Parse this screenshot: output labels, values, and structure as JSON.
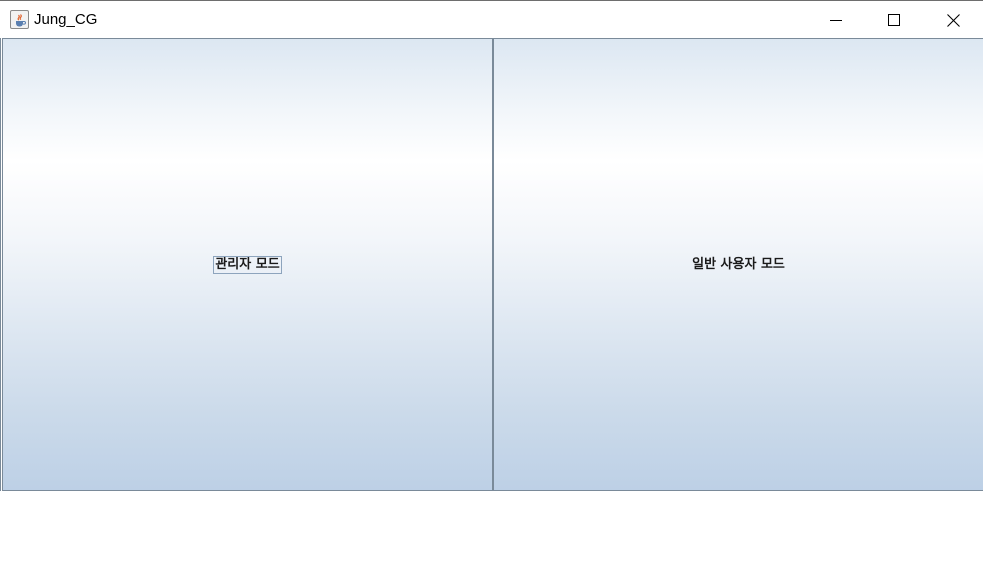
{
  "window": {
    "title": "Jung_CG",
    "app_icon": "java-coffee-icon",
    "controls": {
      "minimize_icon": "minimize-icon",
      "maximize_icon": "maximize-icon",
      "close_icon": "close-icon"
    }
  },
  "buttons": {
    "admin_label": "관리자 모드",
    "user_label": "일반 사용자 모드"
  },
  "colors": {
    "gradient_top": "#dce7f2",
    "gradient_highlight": "#ffffff",
    "gradient_bottom": "#bdd0e6",
    "border": "#7a8a99",
    "focus_outline": "#8da4bd"
  }
}
